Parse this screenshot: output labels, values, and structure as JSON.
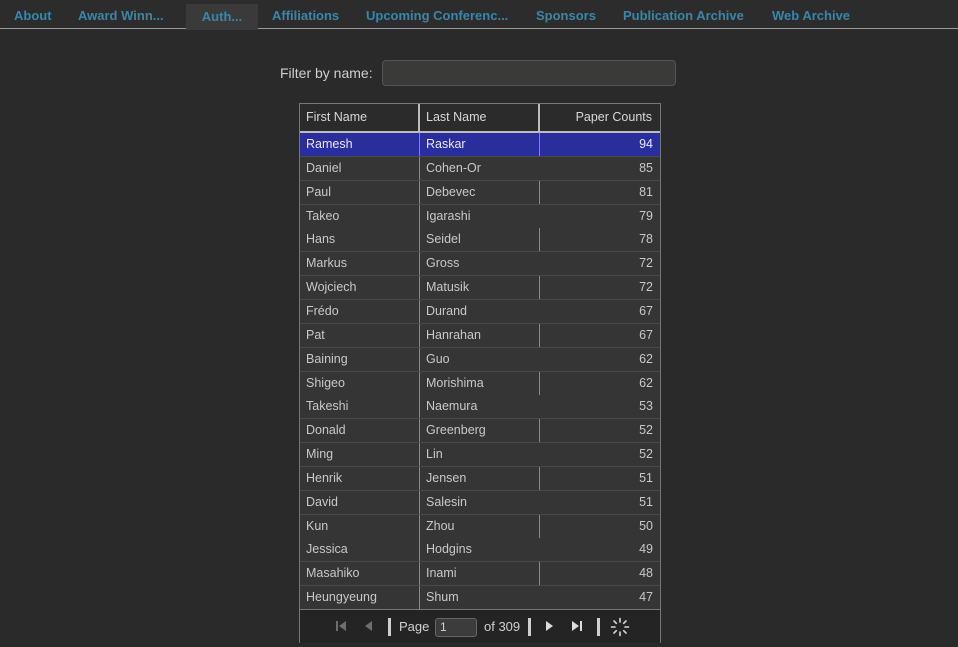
{
  "tabs": [
    {
      "label": "About"
    },
    {
      "label": "Award Winn..."
    },
    {
      "label": "Auth..."
    },
    {
      "label": "Affiliations"
    },
    {
      "label": "Upcoming Conferenc..."
    },
    {
      "label": "Sponsors"
    },
    {
      "label": "Publication Archive"
    },
    {
      "label": "Web Archive"
    }
  ],
  "filter": {
    "label": "Filter by name:",
    "value": ""
  },
  "table": {
    "columns": [
      "First Name",
      "Last Name",
      "Paper Counts"
    ],
    "rows": [
      {
        "first": "Ramesh",
        "last": "Raskar",
        "count": "94"
      },
      {
        "first": "Daniel",
        "last": "Cohen-Or",
        "count": "85"
      },
      {
        "first": "Paul",
        "last": "Debevec",
        "count": "81"
      },
      {
        "first": "Takeo",
        "last": "Igarashi",
        "count": "79"
      },
      {
        "first": "Hans",
        "last": "Seidel",
        "count": "78"
      },
      {
        "first": "Markus",
        "last": "Gross",
        "count": "72"
      },
      {
        "first": "Wojciech",
        "last": "Matusik",
        "count": "72"
      },
      {
        "first": "Frédo",
        "last": "Durand",
        "count": "67"
      },
      {
        "first": "Pat",
        "last": "Hanrahan",
        "count": "67"
      },
      {
        "first": "Baining",
        "last": "Guo",
        "count": "62"
      },
      {
        "first": "Shigeo",
        "last": "Morishima",
        "count": "62"
      },
      {
        "first": "Takeshi",
        "last": "Naemura",
        "count": "53"
      },
      {
        "first": "Donald",
        "last": "Greenberg",
        "count": "52"
      },
      {
        "first": "Ming",
        "last": "Lin",
        "count": "52"
      },
      {
        "first": "Henrik",
        "last": "Jensen",
        "count": "51"
      },
      {
        "first": "David",
        "last": "Salesin",
        "count": "51"
      },
      {
        "first": "Kun",
        "last": "Zhou",
        "count": "50"
      },
      {
        "first": "Jessica",
        "last": "Hodgins",
        "count": "49"
      },
      {
        "first": "Masahiko",
        "last": "Inami",
        "count": "48"
      },
      {
        "first": "Heungyeung",
        "last": "Shum",
        "count": "47"
      }
    ]
  },
  "pager": {
    "page_label": "Page",
    "page_value": "1",
    "of_label": "of 309"
  }
}
